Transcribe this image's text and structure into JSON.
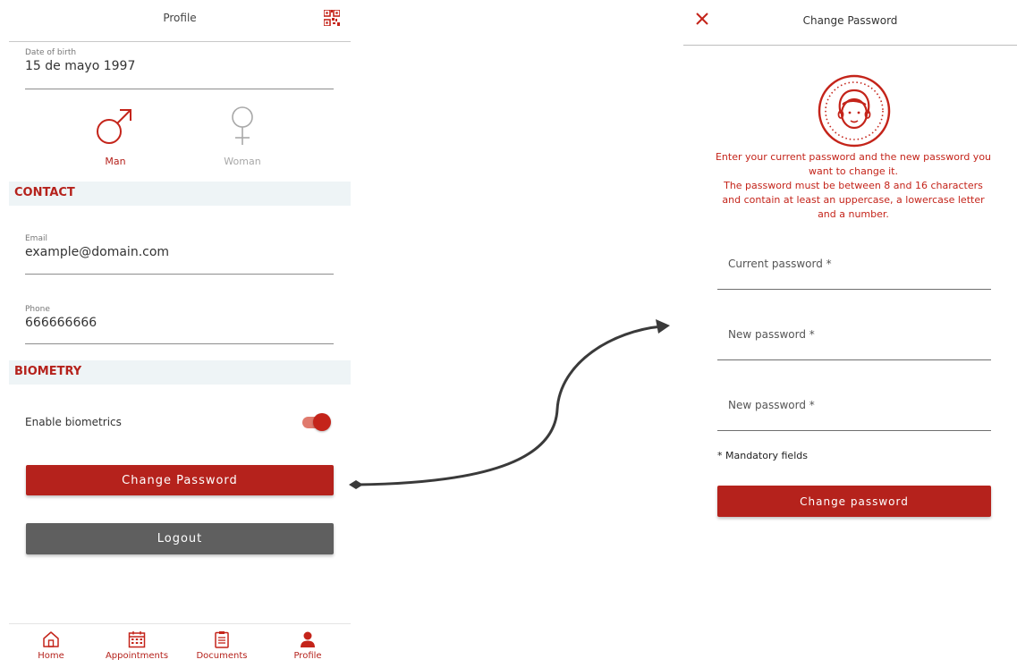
{
  "profile": {
    "title": "Profile",
    "birth": {
      "label": "Date of birth",
      "value": "15 de mayo 1997"
    },
    "gender": {
      "man": "Man",
      "woman": "Woman",
      "selected": "Man"
    },
    "contact": {
      "heading": "CONTACT",
      "email": {
        "label": "Email",
        "value": "example@domain.com"
      },
      "phone": {
        "label": "Phone",
        "value": "666666666"
      }
    },
    "biometry": {
      "heading": "BIOMETRY",
      "toggle_label": "Enable biometrics",
      "enabled": true
    },
    "change_password_label": "Change Password",
    "logout_label": "Logout",
    "tabs": [
      {
        "label": "Home",
        "icon": "home-icon"
      },
      {
        "label": "Appointments",
        "icon": "calendar-icon"
      },
      {
        "label": "Documents",
        "icon": "clipboard-icon"
      },
      {
        "label": "Profile",
        "icon": "user-icon"
      }
    ]
  },
  "change_password": {
    "title": "Change Password",
    "info_lines": [
      "Enter your current password and the new password you",
      "want to change it.",
      "The password must be between 8 and 16 characters",
      "and contain at least an uppercase, a lowercase letter",
      "and a number."
    ],
    "fields": {
      "current_placeholder": "Current password *",
      "new_placeholder": "New password *",
      "repeat_placeholder": "New password *"
    },
    "mandatory_note": "* Mandatory fields",
    "submit_label": "Change password"
  },
  "colors": {
    "accent": "#b5221c",
    "dark_button": "#5f5f5f",
    "section_bg": "#eef4f6"
  }
}
